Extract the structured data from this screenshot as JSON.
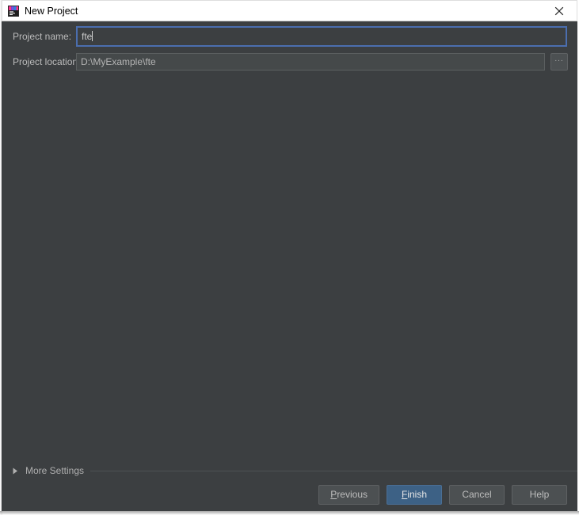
{
  "window": {
    "title": "New Project",
    "app_icon": "intellij-idea-icon",
    "close_icon": "close-icon",
    "background_color": "#3c3f41",
    "titlebar_color": "#ffffff"
  },
  "form": {
    "project_name": {
      "label": "Project name:",
      "value": "fte",
      "placeholder": "",
      "focused": true
    },
    "project_location": {
      "label": "Project location:",
      "value": "D:\\MyExample\\fte",
      "placeholder": "",
      "focused": false
    },
    "browse_button": {
      "label": "...",
      "icon": "ellipsis-icon"
    }
  },
  "more_settings": {
    "label": "More Settings",
    "expanded": false,
    "arrow_icon": "triangle-right-icon"
  },
  "buttons": {
    "previous": {
      "label": "Previous",
      "mnemonic": "P",
      "primary": false
    },
    "finish": {
      "label": "Finish",
      "mnemonic": "F",
      "primary": true
    },
    "cancel": {
      "label": "Cancel",
      "mnemonic": "",
      "primary": false
    },
    "help": {
      "label": "Help",
      "mnemonic": "",
      "primary": false
    }
  },
  "colors": {
    "accent": "#3d6185",
    "focus_border": "#4b6eaf",
    "panel": "#3c3f41",
    "field": "#45494a",
    "text": "#bbbbbb"
  }
}
